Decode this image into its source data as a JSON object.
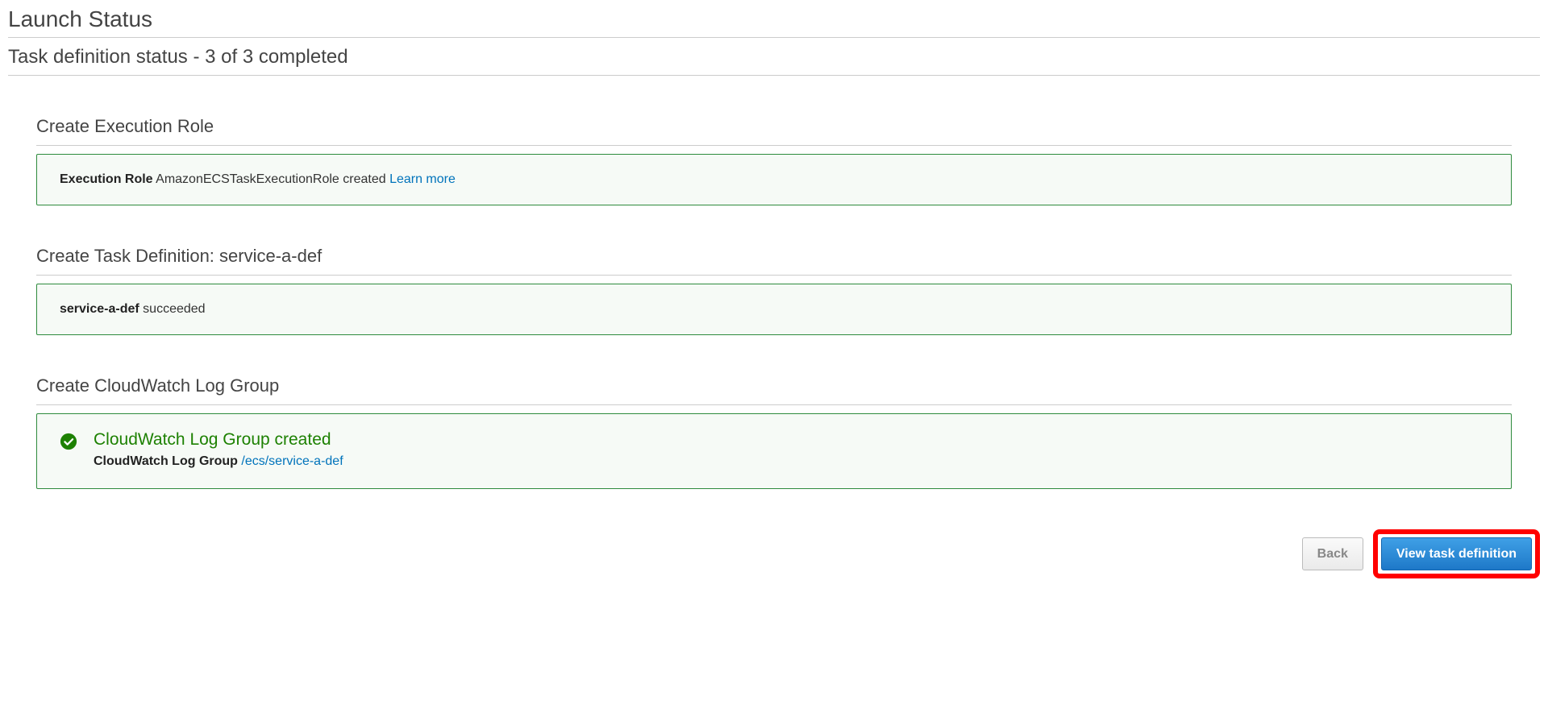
{
  "page": {
    "title": "Launch Status",
    "subtitle": "Task definition status - 3 of 3 completed"
  },
  "sections": {
    "executionRole": {
      "heading": "Create Execution Role",
      "boldText": "Execution Role",
      "message": " AmazonECSTaskExecutionRole created ",
      "link": "Learn more"
    },
    "taskDef": {
      "heading": "Create Task Definition: service-a-def",
      "boldText": "service-a-def",
      "message": " succeeded"
    },
    "logGroup": {
      "heading": "Create CloudWatch Log Group",
      "title": "CloudWatch Log Group created",
      "boldText": "CloudWatch Log Group",
      "link": " /ecs/service-a-def"
    }
  },
  "buttons": {
    "back": "Back",
    "view": "View task definition"
  }
}
